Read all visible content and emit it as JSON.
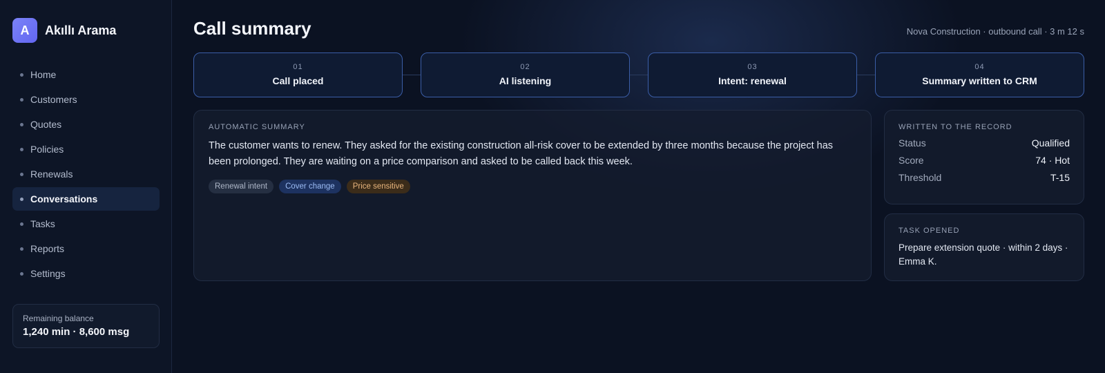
{
  "app": {
    "logo_letter": "A",
    "name": "Akıllı Arama"
  },
  "sidebar": {
    "items": [
      {
        "label": "Home",
        "active": false
      },
      {
        "label": "Customers",
        "active": false
      },
      {
        "label": "Quotes",
        "active": false
      },
      {
        "label": "Policies",
        "active": false
      },
      {
        "label": "Renewals",
        "active": false
      },
      {
        "label": "Conversations",
        "active": true
      },
      {
        "label": "Tasks",
        "active": false
      },
      {
        "label": "Reports",
        "active": false
      },
      {
        "label": "Settings",
        "active": false
      }
    ],
    "balance": {
      "label": "Remaining balance",
      "value": "1,240 min · 8,600 msg"
    }
  },
  "header": {
    "title": "Call summary",
    "meta": "Nova Construction · outbound call · 3 m 12 s"
  },
  "steps": [
    {
      "num": "01",
      "label": "Call placed"
    },
    {
      "num": "02",
      "label": "AI listening"
    },
    {
      "num": "03",
      "label": "Intent: renewal"
    },
    {
      "num": "04",
      "label": "Summary written to CRM"
    }
  ],
  "summary": {
    "title": "AUTOMATIC SUMMARY",
    "text": "The customer wants to renew. They asked for the existing construction all-risk cover to be extended by three months because the project has been prolonged. They are waiting on a price comparison and asked to be called back this week.",
    "tags": [
      "Renewal intent",
      "Cover change",
      "Price sensitive"
    ]
  },
  "record": {
    "title": "WRITTEN TO THE RECORD",
    "rows": [
      {
        "key": "Status",
        "value": "Qualified"
      },
      {
        "key": "Score",
        "value": "74 · Hot"
      },
      {
        "key": "Threshold",
        "value": "T-15"
      }
    ]
  },
  "task": {
    "title": "TASK OPENED",
    "text": "Prepare extension quote · within 2 days · Emma K."
  },
  "colors": {
    "accent": "#6366f1",
    "step_border": "#3b5ea8",
    "tag_info": "#9cbcf5",
    "tag_warning": "#e8b57d"
  }
}
